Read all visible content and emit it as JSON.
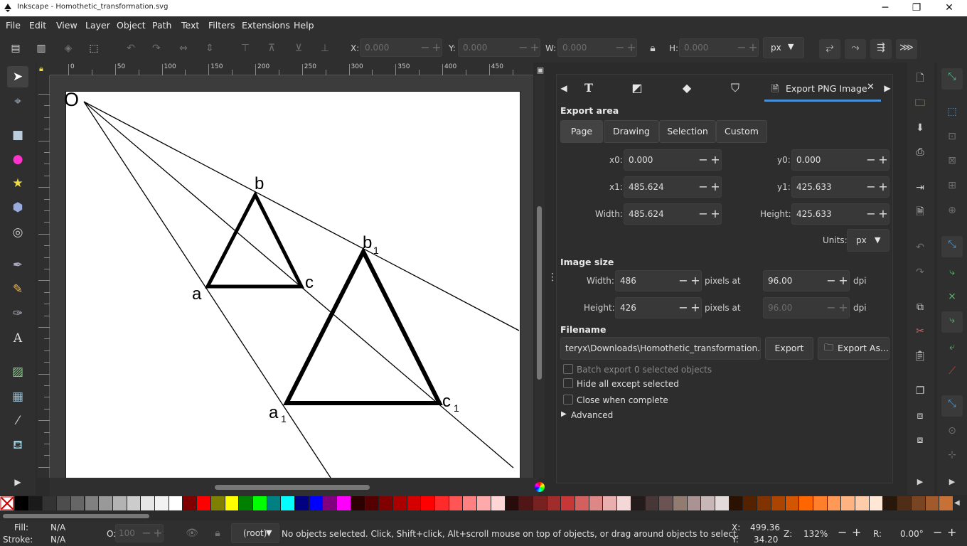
{
  "window": {
    "title": "Inkscape - Homothetic_transformation.svg",
    "controls": [
      "─",
      "❐",
      "✕"
    ]
  },
  "menu": [
    "File",
    "Edit",
    "View",
    "Layer",
    "Object",
    "Path",
    "Text",
    "Filters",
    "Extensions",
    "Help"
  ],
  "toolbar": {
    "x_label": "X:",
    "x_value": "0.000",
    "y_label": "Y:",
    "y_value": "0.000",
    "w_label": "W:",
    "w_value": "0.000",
    "h_label": "H:",
    "h_value": "0.000",
    "unit": "px"
  },
  "ruler": {
    "h_ticks": [
      "0",
      "50",
      "100",
      "150",
      "200",
      "250",
      "300",
      "350",
      "400",
      "450"
    ]
  },
  "drawing": {
    "labels": {
      "O": "O",
      "a": "a",
      "b": "b",
      "c": "c",
      "a1": "a",
      "b1": "b",
      "c1": "c",
      "sub": "1"
    }
  },
  "dock": {
    "tab_label": "Export PNG Image",
    "export_area": {
      "heading": "Export area",
      "buttons": [
        "Page",
        "Drawing",
        "Selection",
        "Custom"
      ],
      "selected": "Page",
      "x0_label": "x0:",
      "x0": "0.000",
      "y0_label": "y0:",
      "y0": "0.000",
      "x1_label": "x1:",
      "x1": "485.624",
      "y1_label": "y1:",
      "y1": "425.633",
      "width_label": "Width:",
      "width": "485.624",
      "height_label": "Height:",
      "height": "425.633",
      "units_label": "Units:",
      "units": "px"
    },
    "image_size": {
      "heading": "Image size",
      "width_label": "Width:",
      "width": "486",
      "height_label": "Height:",
      "height": "426",
      "pixels_at": "pixels at",
      "dpi_x": "96.00",
      "dpi_y": "96.00",
      "dpi_label": "dpi"
    },
    "filename": {
      "heading": "Filename",
      "value": "teryx\\Downloads\\Homothetic_transformation.png",
      "export_button": "Export",
      "export_as_button": "Export As..."
    },
    "options": {
      "batch": "Batch export 0 selected objects",
      "hide": "Hide all except selected",
      "close": "Close when complete",
      "advanced": "Advanced"
    }
  },
  "palette": {
    "colors": [
      "#000000",
      "#1a1a1a",
      "#333333",
      "#4d4d4d",
      "#666666",
      "#808080",
      "#999999",
      "#b3b3b3",
      "#cccccc",
      "#e6e6e6",
      "#f2f2f2",
      "#ffffff",
      "#800000",
      "#ff0000",
      "#808000",
      "#ffff00",
      "#008000",
      "#00ff00",
      "#008080",
      "#00ffff",
      "#000080",
      "#0000ff",
      "#800080",
      "#ff00ff",
      "#2b0000",
      "#550000",
      "#800000",
      "#aa0000",
      "#d40000",
      "#ff0000",
      "#ff2a2a",
      "#ff5555",
      "#ff8080",
      "#ffaaaa",
      "#ffd5d5",
      "#280b0b",
      "#501616",
      "#782121",
      "#a02c2c",
      "#c83737",
      "#d35f5f",
      "#de8787",
      "#e9afaf",
      "#f4d7d7",
      "#241c1c",
      "#483737",
      "#6c5353",
      "#917c6f",
      "#ac9393",
      "#c8b7b7",
      "#e3dbdb",
      "#2b1100",
      "#552200",
      "#803300",
      "#aa4400",
      "#d45500",
      "#ff6600",
      "#ff7f2a",
      "#ff9955",
      "#ffb380",
      "#ffccaa",
      "#ffe6d5",
      "#28170b",
      "#502d16",
      "#784421",
      "#a05a2c",
      "#c87137"
    ]
  },
  "status": {
    "fill_label": "Fill:",
    "fill_value": "N/A",
    "stroke_label": "Stroke:",
    "stroke_value": "N/A",
    "opacity_label": "O:",
    "opacity_value": "100",
    "layer": "(root)",
    "message": "No objects selected. Click, Shift+click, Alt+scroll mouse on top of objects, or drag around objects to select.",
    "x_label": "X:",
    "x_value": "499.36",
    "y_label": "Y:",
    "y_value": "34.20",
    "zoom_label": "Z:",
    "zoom_value": "132%",
    "rot_label": "R:",
    "rot_value": "0.00°"
  }
}
